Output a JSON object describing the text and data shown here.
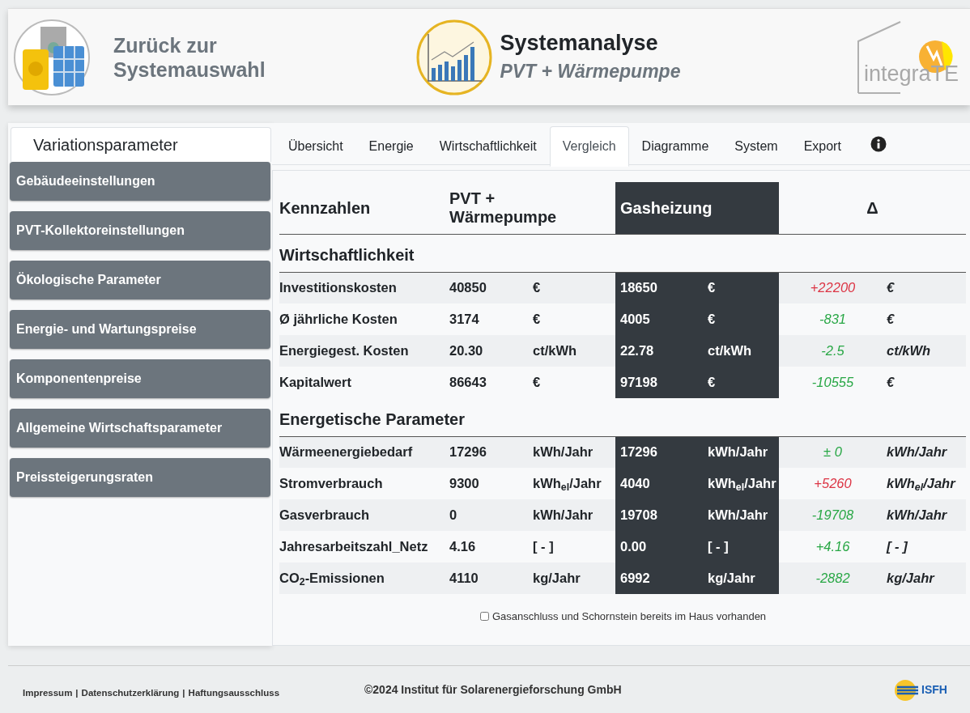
{
  "header": {
    "back_link": "Zurück zur Systemauswahl",
    "title": "Systemanalyse",
    "subtitle": "PVT + Wärmepumpe",
    "logo_text": "integraTE"
  },
  "sidebar": {
    "title": "Variationsparameter",
    "items": [
      "Gebäudeeinstellungen",
      "PVT-Kollektoreinstellungen",
      "Ökologische Parameter",
      "Energie- und Wartungspreise",
      "Komponentenpreise",
      "Allgemeine Wirtschaftsparameter",
      "Preissteigerungsraten"
    ]
  },
  "tabs": [
    {
      "label": "Übersicht",
      "selected": false
    },
    {
      "label": "Energie",
      "selected": false
    },
    {
      "label": "Wirtschaftlichkeit",
      "selected": false
    },
    {
      "label": "Vergleich",
      "selected": true
    },
    {
      "label": "Diagramme",
      "selected": false
    },
    {
      "label": "System",
      "selected": false
    },
    {
      "label": "Export",
      "selected": false
    }
  ],
  "table": {
    "columns": [
      "Kennzahlen",
      "PVT + Wärmepumpe",
      "Gasheizung",
      "Δ"
    ],
    "sections": [
      {
        "title": "Wirtschaftlichkeit",
        "rows": [
          {
            "label": "Investitionskosten",
            "pvt": "40850",
            "pvt_unit": "€",
            "gas": "18650",
            "gas_unit": "€",
            "delta": "+22200",
            "color": "#dc3545",
            "delta_unit": "€"
          },
          {
            "label": "Ø jährliche Kosten",
            "pvt": "3174",
            "pvt_unit": "€",
            "gas": "4005",
            "gas_unit": "€",
            "delta": "-831",
            "color": "#28a745",
            "delta_unit": "€"
          },
          {
            "label": "Energiegest. Kosten",
            "pvt": "20.30",
            "pvt_unit": "ct/kWh",
            "gas": "22.78",
            "gas_unit": "ct/kWh",
            "delta": "-2.5",
            "color": "#28a745",
            "delta_unit": "ct/kWh"
          },
          {
            "label": "Kapitalwert",
            "pvt": "86643",
            "pvt_unit": "€",
            "gas": "97198",
            "gas_unit": "€",
            "delta": "-10555",
            "color": "#28a745",
            "delta_unit": "€"
          }
        ]
      },
      {
        "title": "Energetische Parameter",
        "rows": [
          {
            "label": "Wärmeenergiebedarf",
            "pvt": "17296",
            "pvt_unit": "kWh/Jahr",
            "gas": "17296",
            "gas_unit": "kWh/Jahr",
            "delta": "± 0",
            "color": "#28a745",
            "delta_unit": "kWh/Jahr"
          },
          {
            "label": "Stromverbrauch",
            "pvt": "9300",
            "pvt_unit": "kWh$_{el}$/Jahr",
            "gas": "4040",
            "gas_unit": "kWh$_{el}$/Jahr",
            "delta": "+5260",
            "color": "#dc3545",
            "delta_unit": "kWh$_{el}$/Jahr"
          },
          {
            "label": "Gasverbrauch",
            "pvt": "0",
            "pvt_unit": "kWh/Jahr",
            "gas": "19708",
            "gas_unit": "kWh/Jahr",
            "delta": "-19708",
            "color": "#28a745",
            "delta_unit": "kWh/Jahr"
          },
          {
            "label": "Jahresarbeitszahl_Netz",
            "pvt": "4.16",
            "pvt_unit": "[ - ]",
            "gas": "0.00",
            "gas_unit": "[ - ]",
            "delta": "+4.16",
            "color": "#28a745",
            "delta_unit": "[ - ]"
          },
          {
            "label": "CO$_{2}$-Emissionen",
            "pvt": "4110",
            "pvt_unit": "kg/Jahr",
            "gas": "6992",
            "gas_unit": "kg/Jahr",
            "delta": "-2882",
            "color": "#28a745",
            "delta_unit": "kg/Jahr"
          }
        ]
      }
    ]
  },
  "checkbox": {
    "label": "Gasanschluss und Schornstein bereits im Haus vorhanden",
    "checked": false
  },
  "footer": {
    "links": [
      "Impressum",
      "Datenschutzerklärung",
      "Haftungsausschluss"
    ],
    "separator": "|",
    "copyright": "©2024 Institut für Solarenergieforschung GmbH",
    "logo_text": "ISFH"
  }
}
